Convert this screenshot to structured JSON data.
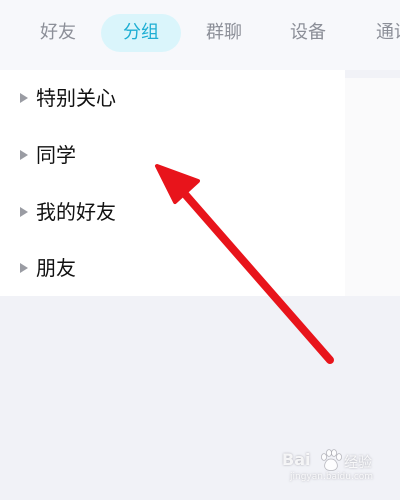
{
  "tabs": [
    {
      "label": "好友",
      "active": false
    },
    {
      "label": "分组",
      "active": true
    },
    {
      "label": "群聊",
      "active": false
    },
    {
      "label": "设备",
      "active": false
    },
    {
      "label": "通讯",
      "active": false
    }
  ],
  "groups": [
    {
      "label": "特别关心",
      "icon": "caret-right-icon"
    },
    {
      "label": "同学",
      "icon": "caret-right-icon"
    },
    {
      "label": "我的好友",
      "icon": "caret-right-icon"
    },
    {
      "label": "朋友",
      "icon": "caret-right-icon"
    }
  ],
  "annotation": {
    "icon": "red-arrow-icon",
    "color": "#e8141b"
  },
  "watermark": {
    "brand": "Bai",
    "icon": "paw-icon",
    "sub": "经验",
    "url": "jingyan.baidu.com"
  },
  "colors": {
    "accent": "#1eaed3",
    "active_tab_bg": "#daf5fb",
    "inactive_tab": "#8c8f98"
  }
}
